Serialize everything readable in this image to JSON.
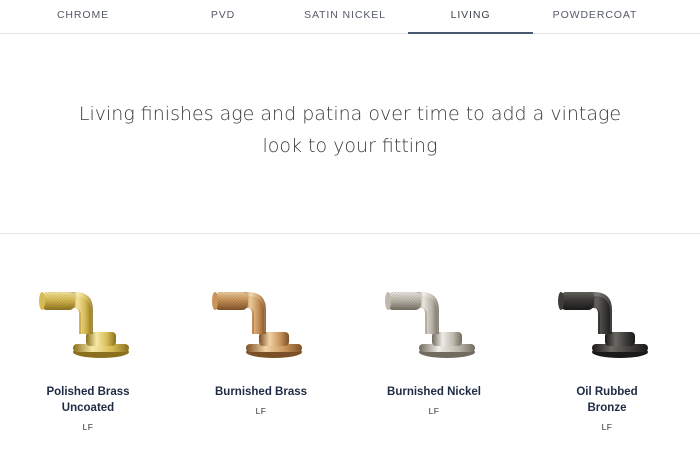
{
  "tabs": [
    {
      "label": "CHROME"
    },
    {
      "label": "PVD"
    },
    {
      "label": "SATIN NICKEL"
    },
    {
      "label": "LIVING",
      "active": true
    },
    {
      "label": "POWDERCOAT"
    }
  ],
  "intro": {
    "line1": "Living finishes age and patina over time to add a vintage",
    "line2": "look to your fitting"
  },
  "finishes": [
    {
      "name": "Polished Brass Uncoated",
      "code": "LF",
      "icon": "faucet-handle-icon",
      "light": "#f6e9a8",
      "mid": "#d7bc55",
      "dark": "#8a6f1c"
    },
    {
      "name": "Burnished Brass",
      "code": "LF",
      "icon": "faucet-handle-icon",
      "light": "#f1d2a6",
      "mid": "#c9935a",
      "dark": "#7c5026"
    },
    {
      "name": "Burnished Nickel",
      "code": "LF",
      "icon": "faucet-handle-icon",
      "light": "#eeece7",
      "mid": "#bfb9ae",
      "dark": "#716a5f"
    },
    {
      "name": "Oil Rubbed Bronze",
      "code": "LF",
      "icon": "faucet-handle-icon",
      "light": "#6a6863",
      "mid": "#3e3c39",
      "dark": "#1b1a19"
    }
  ]
}
